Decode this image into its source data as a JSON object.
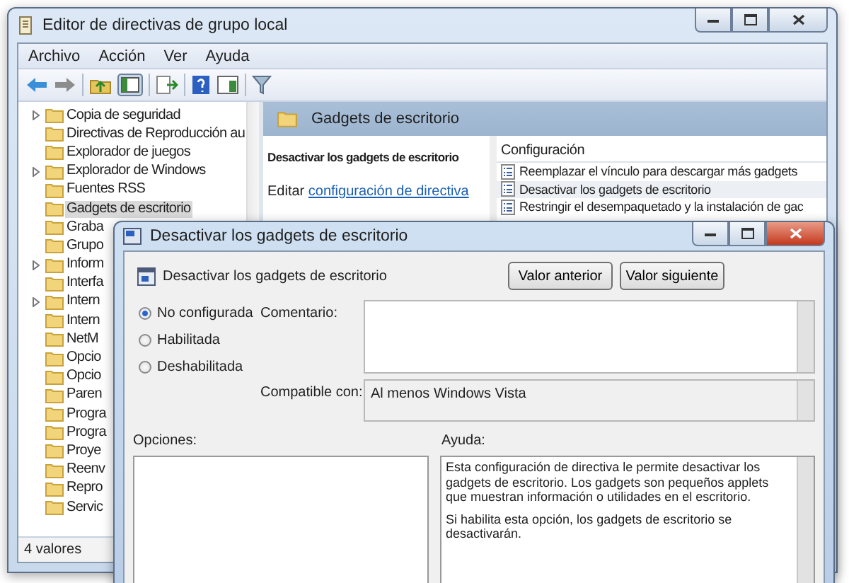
{
  "main_window": {
    "title": "Editor de directivas de grupo local",
    "menu": [
      "Archivo",
      "Acción",
      "Ver",
      "Ayuda"
    ],
    "tree": [
      {
        "label": "Copia de seguridad",
        "expandable": true,
        "selected": false
      },
      {
        "label": "Directivas de Reproducción au",
        "expandable": false,
        "selected": false
      },
      {
        "label": "Explorador de juegos",
        "expandable": false,
        "selected": false
      },
      {
        "label": "Explorador de Windows",
        "expandable": true,
        "selected": false
      },
      {
        "label": "Fuentes RSS",
        "expandable": false,
        "selected": false
      },
      {
        "label": "Gadgets de escritorio",
        "expandable": false,
        "selected": true
      },
      {
        "label": "Graba",
        "expandable": false,
        "selected": false
      },
      {
        "label": "Grupo",
        "expandable": false,
        "selected": false
      },
      {
        "label": "Inform",
        "expandable": true,
        "selected": false
      },
      {
        "label": "Interfa",
        "expandable": false,
        "selected": false
      },
      {
        "label": "Intern",
        "expandable": true,
        "selected": false
      },
      {
        "label": "Intern",
        "expandable": false,
        "selected": false
      },
      {
        "label": "NetM",
        "expandable": false,
        "selected": false
      },
      {
        "label": "Opcio",
        "expandable": false,
        "selected": false
      },
      {
        "label": "Opcio",
        "expandable": false,
        "selected": false
      },
      {
        "label": "Paren",
        "expandable": false,
        "selected": false
      },
      {
        "label": "Progra",
        "expandable": false,
        "selected": false
      },
      {
        "label": "Progra",
        "expandable": false,
        "selected": false
      },
      {
        "label": "Proye",
        "expandable": false,
        "selected": false
      },
      {
        "label": "Reenv",
        "expandable": false,
        "selected": false
      },
      {
        "label": "Repro",
        "expandable": false,
        "selected": false
      },
      {
        "label": "Servic",
        "expandable": false,
        "selected": false
      }
    ],
    "detail": {
      "header": "Gadgets de escritorio",
      "policy_title": "Desactivar los gadgets de escritorio",
      "edit_prefix": "Editar",
      "edit_link": "configuración de directiva",
      "column": "Configuración",
      "settings": [
        {
          "label": "Reemplazar el vínculo para descargar más gadgets",
          "selected": false
        },
        {
          "label": "Desactivar los gadgets de escritorio",
          "selected": true
        },
        {
          "label": "Restringir el desempaquetado y la instalación de gac",
          "selected": false
        }
      ]
    },
    "status_bar": "4 valores"
  },
  "dialog": {
    "title": "Desactivar los gadgets de escritorio",
    "heading": "Desactivar los gadgets de escritorio",
    "buttons": [
      "Valor anterior",
      "Valor siguiente"
    ],
    "states": [
      {
        "label": "No configurada",
        "selected": true
      },
      {
        "label": "Habilitada",
        "selected": false
      },
      {
        "label": "Deshabilitada",
        "selected": false
      }
    ],
    "comment_label": "Comentario:",
    "compatible_label": "Compatible con:",
    "compatible_value": "Al menos Windows Vista",
    "options_label": "Opciones:",
    "help_label": "Ayuda:",
    "help_paragraphs": [
      "Esta configuración de directiva le permite desactivar los gadgets de escritorio. Los gadgets son pequeños applets que muestran información o utilidades en el escritorio.",
      "Si habilita esta opción, los gadgets de escritorio se desactivarán."
    ]
  }
}
